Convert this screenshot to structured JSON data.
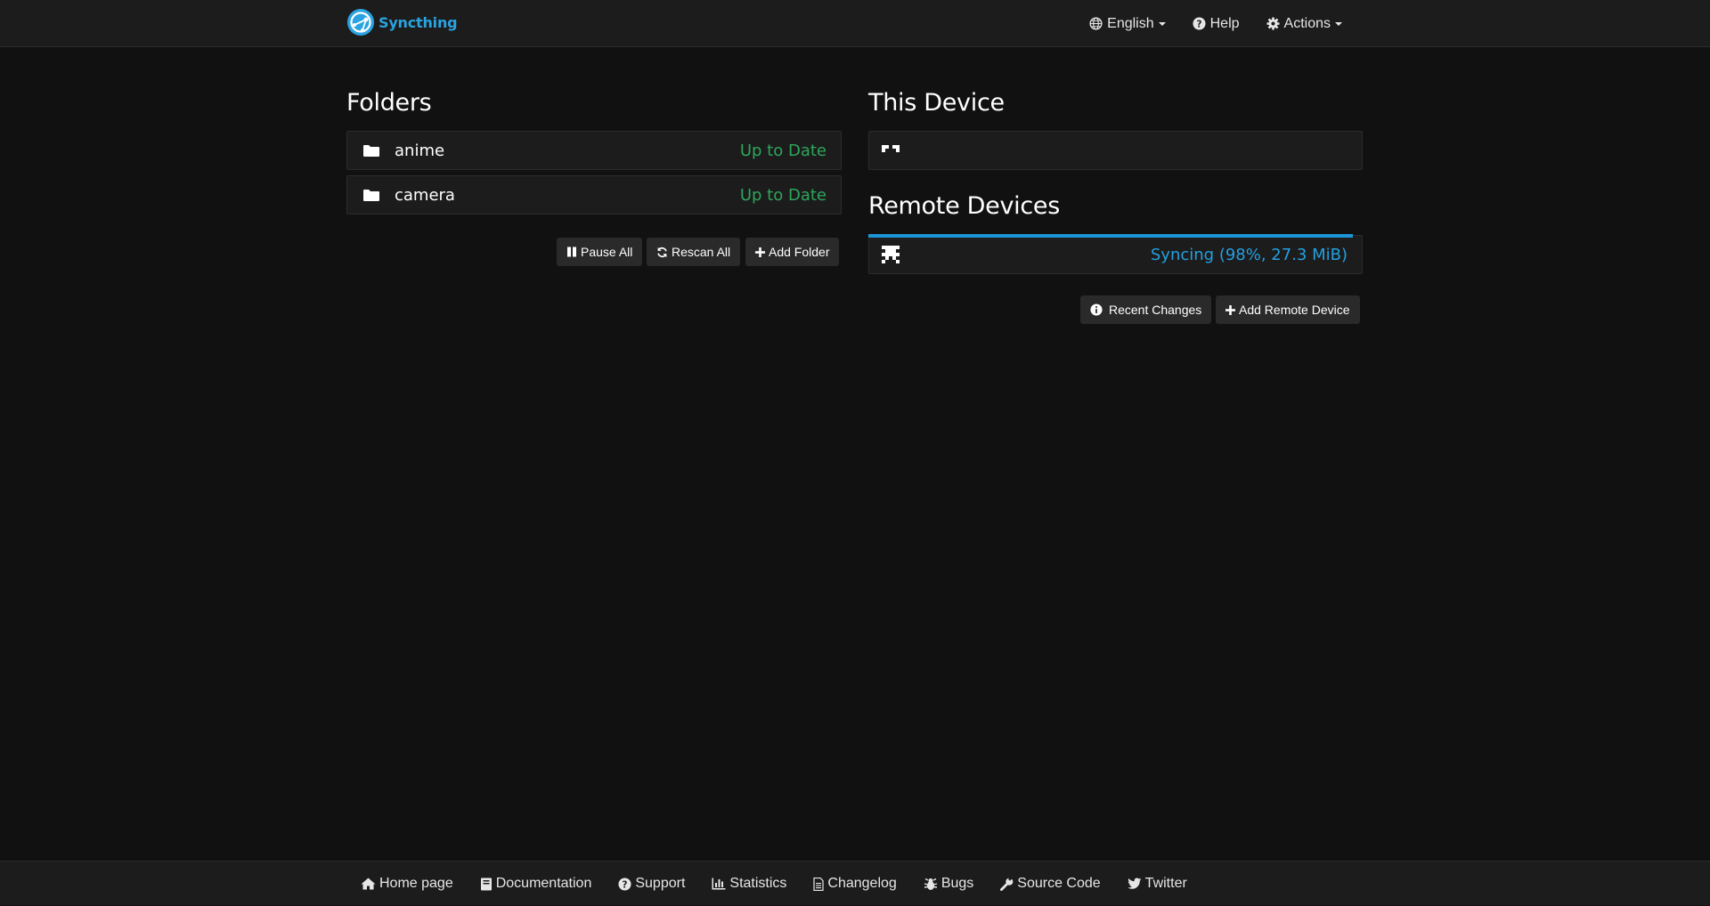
{
  "navbar": {
    "brand": "Syncthing",
    "language": "English",
    "help": "Help",
    "actions": "Actions"
  },
  "folders": {
    "title": "Folders",
    "items": [
      {
        "name": "anime",
        "status": "Up to Date"
      },
      {
        "name": "camera",
        "status": "Up to Date"
      }
    ],
    "buttons": {
      "pause_all": "Pause All",
      "rescan_all": "Rescan All",
      "add_folder": "Add Folder"
    }
  },
  "this_device": {
    "title": "This Device"
  },
  "remote_devices": {
    "title": "Remote Devices",
    "items": [
      {
        "status": "Syncing (98%, 27.3 MiB)",
        "progress_percent": 98
      }
    ],
    "buttons": {
      "recent_changes": "Recent Changes",
      "add_remote_device": "Add Remote Device"
    }
  },
  "footer": {
    "links": [
      "Home page",
      "Documentation",
      "Support",
      "Statistics",
      "Changelog",
      "Bugs",
      "Source Code",
      "Twitter"
    ]
  },
  "colors": {
    "background": "#111111",
    "panel": "#1c1c1c",
    "brand": "#2aa3e0",
    "up_to_date": "#2fa55b",
    "syncing": "#24a0e0"
  }
}
